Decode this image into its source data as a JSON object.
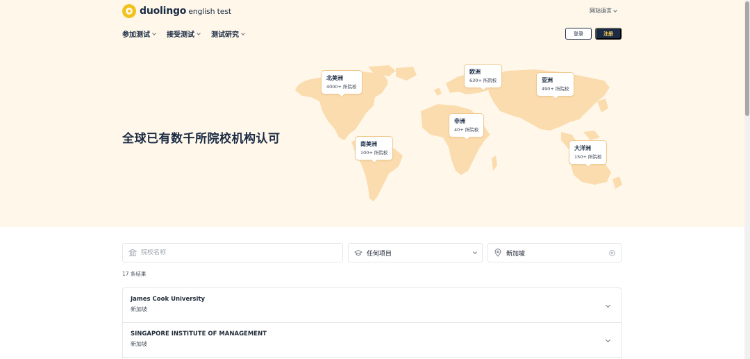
{
  "header": {
    "logo_main": "duolingo",
    "logo_sub": "english test",
    "site_language_label": "网站语言",
    "nav": [
      {
        "label": "参加测试"
      },
      {
        "label": "接受测试"
      },
      {
        "label": "测试研究"
      }
    ],
    "login_label": "登录",
    "signup_label": "注册"
  },
  "hero": {
    "title": "全球已有数千所院校机构认可",
    "regions": [
      {
        "name": "北美洲",
        "count": "4000+ 所院校"
      },
      {
        "name": "欧洲",
        "count": "630+ 所院校"
      },
      {
        "name": "亚洲",
        "count": "490+ 所院校"
      },
      {
        "name": "非洲",
        "count": "40+ 所院校"
      },
      {
        "name": "南美洲",
        "count": "100+ 所院校"
      },
      {
        "name": "大洋洲",
        "count": "150+ 所院校"
      }
    ]
  },
  "search": {
    "school_placeholder": "院校名称",
    "program_value": "任何项目",
    "location_value": "新加坡"
  },
  "results": {
    "count_text": "17 条结果",
    "items": [
      {
        "name": "James Cook University",
        "location": "新加坡"
      },
      {
        "name": "SINGAPORE INSTITUTE OF MANAGEMENT",
        "location": "新加坡"
      }
    ]
  },
  "colors": {
    "brand_navy": "#1b2b45",
    "brand_yellow": "#f2c21c",
    "hero_bg": "#fff8ea",
    "map_land": "#fbdcae"
  },
  "icons": [
    "logo-icon",
    "chevron-down-icon",
    "bank-icon",
    "graduation-cap-icon",
    "location-pin-icon",
    "clear-icon"
  ]
}
